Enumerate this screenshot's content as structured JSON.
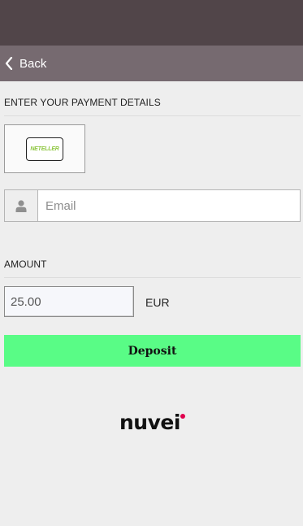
{
  "nav": {
    "back_label": "Back"
  },
  "payment": {
    "section_title": "ENTER YOUR PAYMENT DETAILS",
    "method_logo_text": "NETELLER",
    "email_placeholder": "Email"
  },
  "amount": {
    "section_title": "AMOUNT",
    "value": "25.00",
    "currency": "EUR"
  },
  "actions": {
    "deposit_label": "Deposit"
  },
  "branding": {
    "logo_text": "nuvei"
  },
  "colors": {
    "status_bar": "#514549",
    "nav_bar": "#766a70",
    "deposit_button": "#59fc86",
    "neteller_green": "#8dc63f",
    "brand_dot": "#e0004d"
  },
  "icons": {
    "back": "chevron-left-icon",
    "email_addon": "user-icon"
  }
}
